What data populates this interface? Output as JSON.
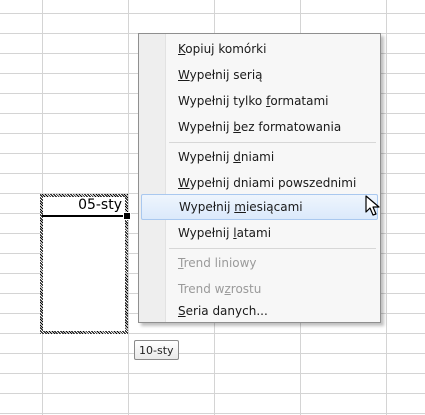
{
  "sheet": {
    "selected_cell_value": "05-sty",
    "tooltip": "10-sty"
  },
  "context_menu": {
    "items": [
      {
        "pre": "",
        "u": "K",
        "post": "opiuj komórki",
        "disabled": false
      },
      {
        "pre": "",
        "u": "W",
        "post": "ypełnij serią",
        "disabled": false
      },
      {
        "pre": "Wypełnij tylko ",
        "u": "f",
        "post": "ormatami",
        "disabled": false
      },
      {
        "pre": "Wypełnij ",
        "u": "b",
        "post": "ez formatowania",
        "disabled": false
      },
      {
        "pre": "Wypełnij ",
        "u": "d",
        "post": "niami",
        "disabled": false
      },
      {
        "pre": "",
        "u": "W",
        "post": "ypełnij dniami powszednimi",
        "disabled": false
      },
      {
        "pre": "Wypełnij ",
        "u": "m",
        "post": "iesiącami",
        "disabled": false
      },
      {
        "pre": "Wypełnij ",
        "u": "l",
        "post": "atami",
        "disabled": false
      },
      {
        "pre": "",
        "u": "T",
        "post": "rend liniowy",
        "disabled": true
      },
      {
        "pre": "Trend w",
        "u": "z",
        "post": "rostu",
        "disabled": true
      },
      {
        "pre": "",
        "u": "S",
        "post": "eria danych...",
        "disabled": false
      }
    ],
    "hovered_index": 6
  },
  "icons": {
    "cursor": "mouse-pointer-icon"
  }
}
